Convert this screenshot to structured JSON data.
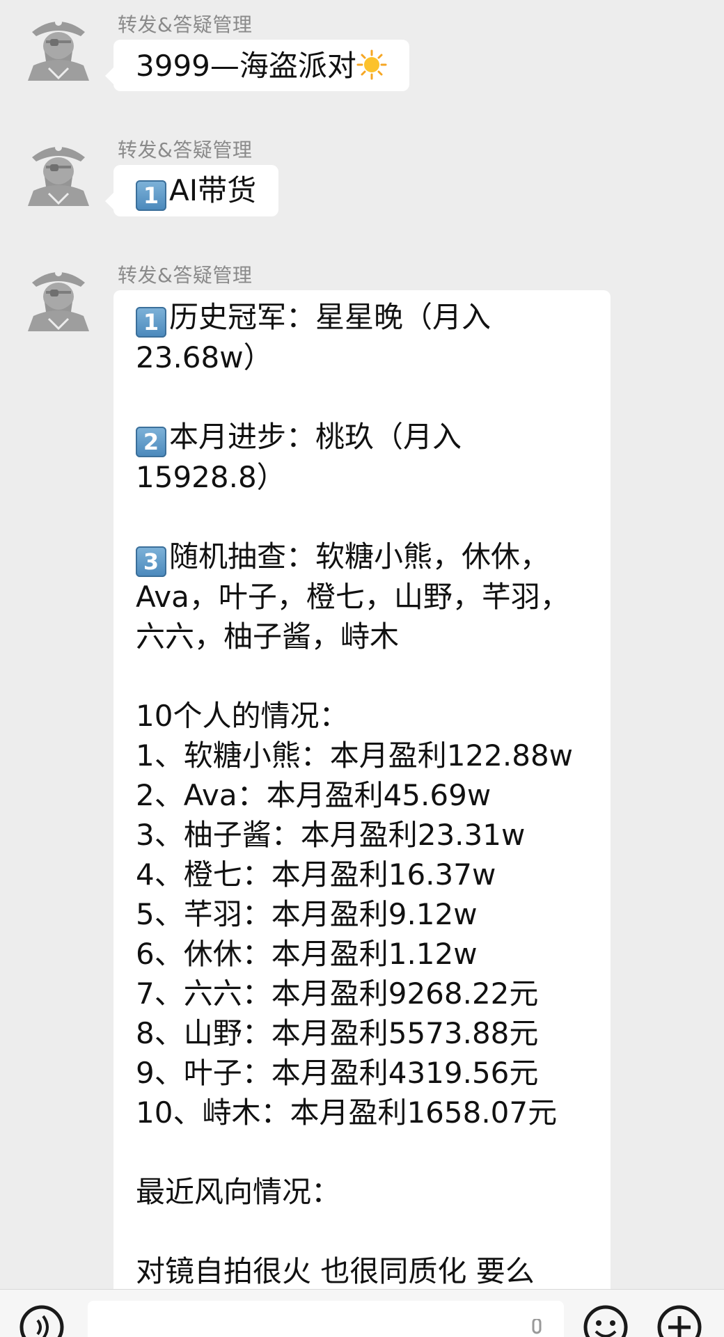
{
  "messages": [
    {
      "sender": "转发&答疑管理",
      "lines": [
        "3999—海盗派对"
      ],
      "emoji": "sun-emoji"
    },
    {
      "sender": "转发&答疑管理",
      "badge": "1",
      "text": "AI带货"
    },
    {
      "sender": "转发&答疑管理",
      "content": [
        {
          "badge": "1",
          "text": "历史冠军：星星晚（月入"
        },
        {
          "text": "23.68w）"
        },
        {
          "text": ""
        },
        {
          "badge": "2",
          "text": "本月进步：桃玖（月入"
        },
        {
          "text": "15928.8）"
        },
        {
          "text": ""
        },
        {
          "badge": "3",
          "text": "随机抽查：软糖小熊，休休，"
        },
        {
          "text": "Ava，叶子，橙七，山野，芊羽，"
        },
        {
          "text": "六六，柚子酱，峙木"
        },
        {
          "text": ""
        },
        {
          "text": "10个人的情况："
        },
        {
          "text": "1、软糖小熊：本月盈利122.88w"
        },
        {
          "text": "2、Ava：本月盈利45.69w"
        },
        {
          "text": "3、柚子酱：本月盈利23.31w"
        },
        {
          "text": "4、橙七：本月盈利16.37w"
        },
        {
          "text": "5、芊羽：本月盈利9.12w"
        },
        {
          "text": "6、休休：本月盈利1.12w"
        },
        {
          "text": "7、六六：本月盈利9268.22元"
        },
        {
          "text": "8、山野：本月盈利5573.88元"
        },
        {
          "text": "9、叶子：本月盈利4319.56元"
        },
        {
          "text": "10、峙木：本月盈利1658.07元"
        },
        {
          "text": ""
        },
        {
          "text": "最近风向情况："
        },
        {
          "text": ""
        },
        {
          "text": "对镜自拍很火 也很同质化 要么"
        }
      ]
    }
  ],
  "bottom_bar": {
    "icons": [
      "voice-icon",
      "emoji-icon",
      "add-icon"
    ]
  },
  "colors": {
    "background": "#ededed",
    "bubble": "#ffffff",
    "sender": "#8a8a8a",
    "keycap": "#4a88bb"
  }
}
